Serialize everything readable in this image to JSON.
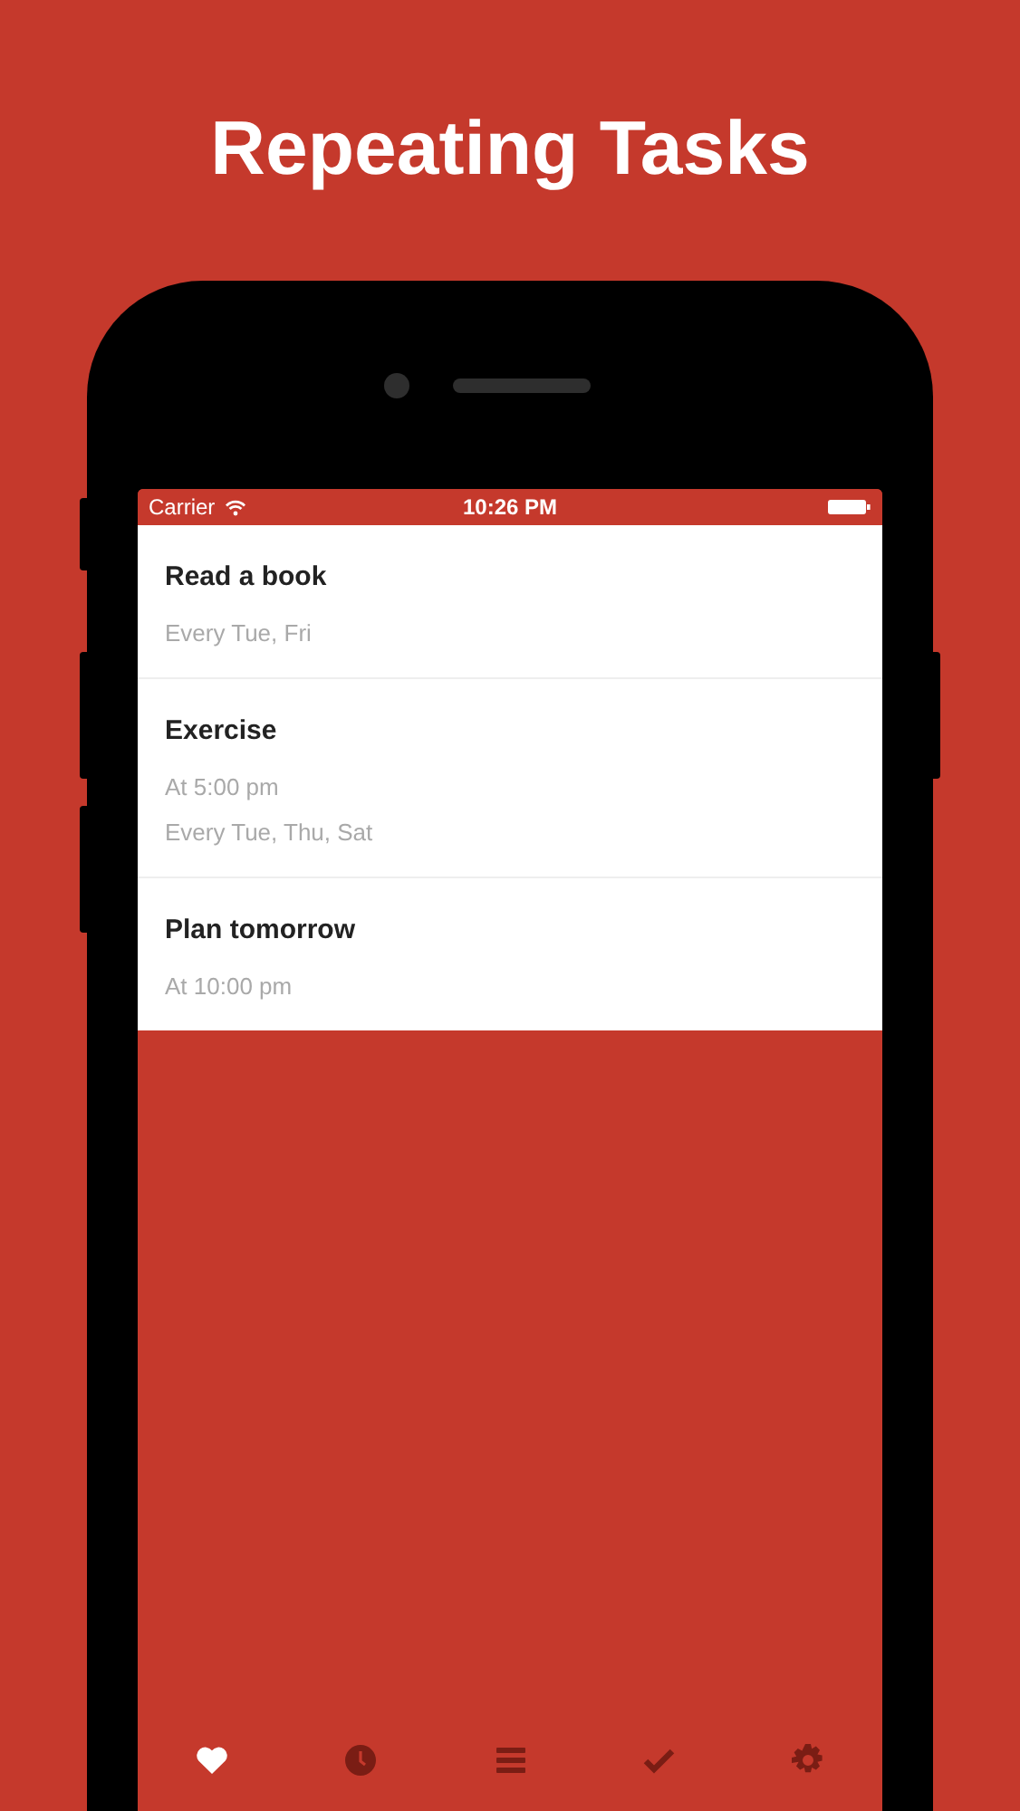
{
  "headline": "Repeating Tasks",
  "status_bar": {
    "carrier": "Carrier",
    "time": "10:26 PM"
  },
  "tasks": [
    {
      "title": "Read a book",
      "details": [
        "Every Tue, Fri"
      ]
    },
    {
      "title": "Exercise",
      "details": [
        "At 5:00 pm",
        "Every Tue, Thu, Sat"
      ]
    },
    {
      "title": "Plan tomorrow",
      "details": [
        "At 10:00 pm"
      ]
    }
  ],
  "tab_bar": [
    {
      "kind": "heart",
      "selected": true
    },
    {
      "kind": "clock",
      "selected": false
    },
    {
      "kind": "list",
      "selected": false
    },
    {
      "kind": "check",
      "selected": false
    },
    {
      "kind": "gear",
      "selected": false
    }
  ]
}
